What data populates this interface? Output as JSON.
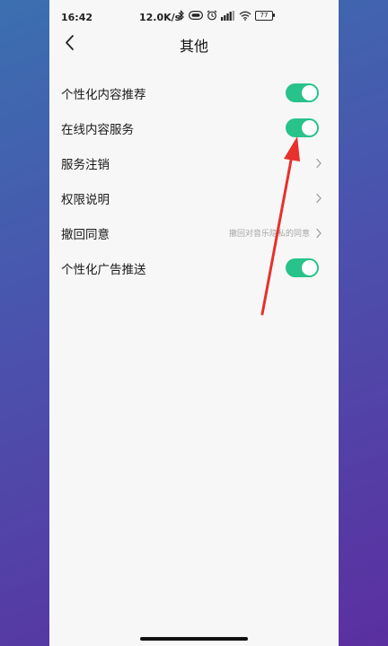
{
  "status_bar": {
    "time": "16:42",
    "network_speed": "12.0K/s",
    "battery": "77"
  },
  "header": {
    "title": "其他"
  },
  "settings": [
    {
      "label": "个性化内容推荐",
      "control": "toggle",
      "on": true
    },
    {
      "label": "在线内容服务",
      "control": "toggle",
      "on": true
    },
    {
      "label": "服务注销",
      "control": "chevron"
    },
    {
      "label": "权限说明",
      "control": "chevron"
    },
    {
      "label": "撤回同意",
      "control": "chevron",
      "value": "撤回对音乐隐私的同意"
    },
    {
      "label": "个性化广告推送",
      "control": "toggle",
      "on": true
    }
  ],
  "colors": {
    "toggle_on": "#27c38a",
    "annotation_arrow": "#e8302c",
    "page_background": "#f7f7f7"
  }
}
